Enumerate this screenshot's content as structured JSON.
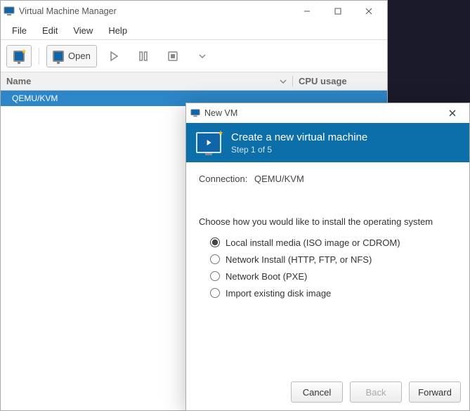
{
  "mainWindow": {
    "title": "Virtual Machine Manager",
    "menus": {
      "file": "File",
      "edit": "Edit",
      "view": "View",
      "help": "Help"
    },
    "toolbar": {
      "openLabel": "Open"
    },
    "columns": {
      "name": "Name",
      "cpu": "CPU usage"
    },
    "rows": [
      {
        "name": "QEMU/KVM",
        "selected": true
      }
    ]
  },
  "dialog": {
    "title": "New VM",
    "bannerTitle": "Create a new virtual machine",
    "bannerStep": "Step 1 of 5",
    "connectionLabel": "Connection:",
    "connectionValue": "QEMU/KVM",
    "prompt": "Choose how you would like to install the operating system",
    "options": {
      "local": "Local install media (ISO image or CDROM)",
      "network": "Network Install (HTTP, FTP, or NFS)",
      "pxe": "Network Boot (PXE)",
      "import": "Import existing disk image"
    },
    "selectedOption": "local",
    "buttons": {
      "cancel": "Cancel",
      "back": "Back",
      "forward": "Forward"
    },
    "backEnabled": false
  }
}
